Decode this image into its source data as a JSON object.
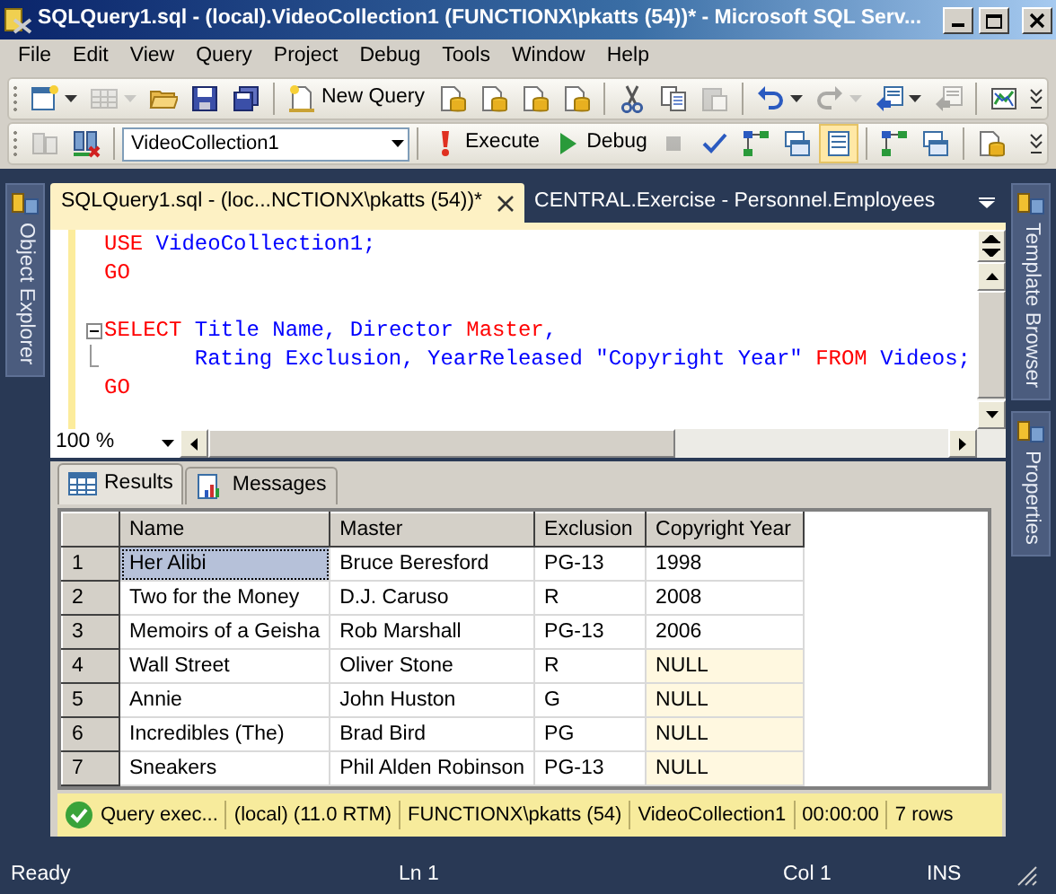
{
  "window": {
    "title": "SQLQuery1.sql - (local).VideoCollection1 (FUNCTIONX\\pkatts (54))* - Microsoft SQL Serv..."
  },
  "menu": [
    "File",
    "Edit",
    "View",
    "Query",
    "Project",
    "Debug",
    "Tools",
    "Window",
    "Help"
  ],
  "toolbars": [
    [
      {
        "kind": "new-project",
        "dropdown": true,
        "disabled": false,
        "pressed": false
      },
      {
        "kind": "grid",
        "dropdown": true,
        "disabled": true,
        "pressed": false
      },
      {
        "kind": "folder",
        "dropdown": false,
        "disabled": false,
        "pressed": false
      },
      {
        "kind": "save",
        "dropdown": false,
        "disabled": false,
        "pressed": false
      },
      {
        "kind": "save-all",
        "dropdown": false,
        "disabled": false,
        "pressed": false
      },
      {
        "kind": "separator"
      },
      {
        "kind": "new-query",
        "label": "New Query",
        "dropdown": false,
        "disabled": false,
        "pressed": false
      },
      {
        "kind": "query-file",
        "dropdown": false,
        "disabled": false,
        "pressed": false
      },
      {
        "kind": "query-file",
        "dropdown": false,
        "disabled": false,
        "pressed": false
      },
      {
        "kind": "query-file",
        "dropdown": false,
        "disabled": false,
        "pressed": false
      },
      {
        "kind": "query-file",
        "dropdown": false,
        "disabled": false,
        "pressed": false
      },
      {
        "kind": "separator"
      },
      {
        "kind": "cut",
        "dropdown": false,
        "disabled": false,
        "pressed": false
      },
      {
        "kind": "copy",
        "dropdown": false,
        "disabled": false,
        "pressed": false
      },
      {
        "kind": "paste",
        "dropdown": false,
        "disabled": true,
        "pressed": false
      },
      {
        "kind": "separator"
      },
      {
        "kind": "undo",
        "dropdown": true,
        "disabled": false,
        "pressed": false
      },
      {
        "kind": "redo",
        "dropdown": true,
        "disabled": true,
        "pressed": false
      },
      {
        "kind": "navigate",
        "dropdown": true,
        "disabled": false,
        "pressed": false
      },
      {
        "kind": "navigate",
        "dropdown": false,
        "disabled": true,
        "pressed": false
      },
      {
        "kind": "separator"
      },
      {
        "kind": "chart",
        "dropdown": false,
        "disabled": false,
        "pressed": false
      }
    ],
    [
      {
        "kind": "server",
        "dropdown": false,
        "disabled": true,
        "pressed": false
      },
      {
        "kind": "server-x",
        "dropdown": false,
        "disabled": false,
        "pressed": false
      },
      {
        "kind": "separator"
      },
      {
        "kind": "combo",
        "value": "VideoCollection1"
      },
      {
        "kind": "separator"
      },
      {
        "kind": "execute",
        "label": "Execute",
        "dropdown": false,
        "disabled": false,
        "pressed": false
      },
      {
        "kind": "debug",
        "label": "Debug",
        "dropdown": false,
        "disabled": false,
        "pressed": false
      },
      {
        "kind": "stop",
        "dropdown": false,
        "disabled": true,
        "pressed": false
      },
      {
        "kind": "check",
        "dropdown": false,
        "disabled": false,
        "pressed": false
      },
      {
        "kind": "plan",
        "dropdown": false,
        "disabled": false,
        "pressed": false
      },
      {
        "kind": "results-text",
        "dropdown": false,
        "disabled": false,
        "pressed": false
      },
      {
        "kind": "results-grid",
        "dropdown": false,
        "disabled": false,
        "pressed": true
      },
      {
        "kind": "separator"
      },
      {
        "kind": "plan",
        "dropdown": false,
        "disabled": false,
        "pressed": false
      },
      {
        "kind": "results-text",
        "dropdown": false,
        "disabled": false,
        "pressed": false
      },
      {
        "kind": "separator"
      },
      {
        "kind": "query-file",
        "dropdown": false,
        "disabled": false,
        "pressed": false
      }
    ]
  ],
  "side_panels": {
    "left": [
      {
        "label": "Object Explorer"
      }
    ],
    "right": [
      {
        "label": "Template Browser"
      },
      {
        "label": "Properties"
      }
    ]
  },
  "document_tabs": [
    {
      "label": "SQLQuery1.sql - (loc...NCTIONX\\pkatts (54))*",
      "selected": true
    },
    {
      "label": "CENTRAL.Exercise - Personnel.Employees",
      "selected": false
    }
  ],
  "editor": {
    "lines": [
      {
        "kind": "code",
        "tokens": [
          {
            "kind": "keyword",
            "text": "USE"
          },
          {
            "kind": "identifier",
            "text": " VideoCollection1;"
          }
        ]
      },
      {
        "kind": "code",
        "tokens": [
          {
            "kind": "keyword",
            "text": "GO"
          }
        ]
      },
      {
        "kind": "blank"
      },
      {
        "kind": "fold-start",
        "tokens": [
          {
            "kind": "keyword",
            "text": "SELECT"
          },
          {
            "kind": "identifier",
            "text": " Title Name, Director "
          },
          {
            "kind": "keyword",
            "text": "Master"
          },
          {
            "kind": "identifier",
            "text": ","
          }
        ]
      },
      {
        "kind": "fold-continue",
        "tokens": [
          {
            "kind": "identifier",
            "text": "       Rating Exclusion, YearReleased \"Copyright Year\" "
          },
          {
            "kind": "keyword",
            "text": "FROM"
          },
          {
            "kind": "identifier",
            "text": " Videos;"
          }
        ]
      },
      {
        "kind": "code",
        "tokens": [
          {
            "kind": "keyword",
            "text": "GO"
          }
        ]
      }
    ],
    "zoom": "100 %"
  },
  "results_tabs": [
    {
      "label": "Results",
      "kind": "grid",
      "selected": true
    },
    {
      "label": "Messages",
      "kind": "messages",
      "selected": false
    }
  ],
  "grid": {
    "columns": [
      "Name",
      "Master",
      "Exclusion",
      "Copyright Year"
    ],
    "rows": [
      {
        "number": "1",
        "cells": [
          {
            "text": "Her Alibi",
            "kind": "value",
            "selected": true
          },
          {
            "text": "Bruce Beresford",
            "kind": "value",
            "selected": false
          },
          {
            "text": "PG-13",
            "kind": "value",
            "selected": false
          },
          {
            "text": "1998",
            "kind": "value",
            "selected": false
          }
        ]
      },
      {
        "number": "2",
        "cells": [
          {
            "text": "Two for the Money",
            "kind": "value",
            "selected": false
          },
          {
            "text": "D.J. Caruso",
            "kind": "value",
            "selected": false
          },
          {
            "text": "R",
            "kind": "value",
            "selected": false
          },
          {
            "text": "2008",
            "kind": "value",
            "selected": false
          }
        ]
      },
      {
        "number": "3",
        "cells": [
          {
            "text": "Memoirs of a Geisha",
            "kind": "value",
            "selected": false
          },
          {
            "text": "Rob Marshall",
            "kind": "value",
            "selected": false
          },
          {
            "text": "PG-13",
            "kind": "value",
            "selected": false
          },
          {
            "text": "2006",
            "kind": "value",
            "selected": false
          }
        ]
      },
      {
        "number": "4",
        "cells": [
          {
            "text": "Wall Street",
            "kind": "value",
            "selected": false
          },
          {
            "text": "Oliver Stone",
            "kind": "value",
            "selected": false
          },
          {
            "text": "R",
            "kind": "value",
            "selected": false
          },
          {
            "text": "NULL",
            "kind": "null",
            "selected": false
          }
        ]
      },
      {
        "number": "5",
        "cells": [
          {
            "text": "Annie",
            "kind": "value",
            "selected": false
          },
          {
            "text": "John Huston",
            "kind": "value",
            "selected": false
          },
          {
            "text": "G",
            "kind": "value",
            "selected": false
          },
          {
            "text": "NULL",
            "kind": "null",
            "selected": false
          }
        ]
      },
      {
        "number": "6",
        "cells": [
          {
            "text": "Incredibles (The)",
            "kind": "value",
            "selected": false
          },
          {
            "text": "Brad Bird",
            "kind": "value",
            "selected": false
          },
          {
            "text": "PG",
            "kind": "value",
            "selected": false
          },
          {
            "text": "NULL",
            "kind": "null",
            "selected": false
          }
        ]
      },
      {
        "number": "7",
        "cells": [
          {
            "text": "Sneakers",
            "kind": "value",
            "selected": false
          },
          {
            "text": "Phil Alden Robinson",
            "kind": "value",
            "selected": false
          },
          {
            "text": "PG-13",
            "kind": "value",
            "selected": false
          },
          {
            "text": "NULL",
            "kind": "null",
            "selected": false
          }
        ]
      }
    ]
  },
  "query_status": {
    "succeeded": true,
    "message": "Query exec...",
    "server": "(local) (11.0 RTM)",
    "user": "FUNCTIONX\\pkatts (54)",
    "database": "VideoCollection1",
    "elapsed": "00:00:00",
    "rows": "7 rows"
  },
  "status_bar": {
    "message": "Ready",
    "line": "Ln 1",
    "column": "Col 1",
    "mode": "INS"
  }
}
